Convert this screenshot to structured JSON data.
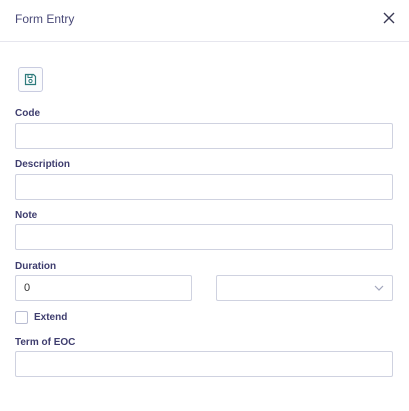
{
  "header": {
    "title": "Form Entry"
  },
  "toolbar": {
    "save_icon": "save-icon"
  },
  "fields": {
    "code": {
      "label": "Code",
      "value": ""
    },
    "description": {
      "label": "Description",
      "value": ""
    },
    "note": {
      "label": "Note",
      "value": ""
    },
    "duration": {
      "label": "Duration",
      "value": "0",
      "unit_selected": ""
    },
    "extend": {
      "label": "Extend",
      "checked": false
    },
    "term_of_eoc": {
      "label": "Term of EOC",
      "value": ""
    }
  },
  "colors": {
    "label": "#3e3d6e",
    "border": "#cfd2e0",
    "save_icon": "#2c7a7b"
  }
}
